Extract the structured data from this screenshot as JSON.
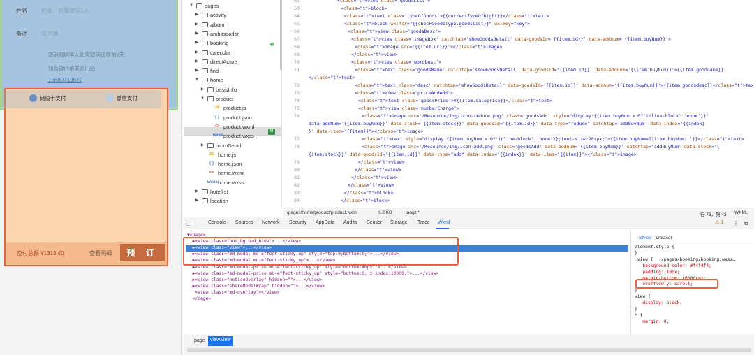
{
  "simulator": {
    "name_label": "姓名",
    "name_placeholder": "姓名，只需填写1人",
    "remark_label": "备注",
    "remark_placeholder": "可不填",
    "note_line1": "取消规则客人如需取消请提前3天;",
    "note_line2": "如有疑问请联系门店",
    "phone": "15680718672",
    "pay_option1": "储值卡支付",
    "pay_option2": "微信支付",
    "total_label": "应付总额 ¥1313.40",
    "detail_link": "查看明细",
    "book_button": "预 订",
    "colors": {
      "top_bg": "#a6c4de",
      "bottom_bg": "#fbd5ae",
      "button": "#c66b3d",
      "highlight": "#e8623a"
    }
  },
  "tree": {
    "items": [
      {
        "label": "pages",
        "kind": "folder-open"
      },
      {
        "label": "activity",
        "kind": "folder"
      },
      {
        "label": "album",
        "kind": "folder"
      },
      {
        "label": "ambassador",
        "kind": "folder"
      },
      {
        "label": "booking",
        "kind": "folder"
      },
      {
        "label": "calendar",
        "kind": "folder"
      },
      {
        "label": "directActive",
        "kind": "folder"
      },
      {
        "label": "find",
        "kind": "folder"
      },
      {
        "label": "home",
        "kind": "folder-open"
      },
      {
        "label": "basisInfo",
        "kind": "folder"
      },
      {
        "label": "product",
        "kind": "folder-open"
      },
      {
        "label": "product.js",
        "kind": "js"
      },
      {
        "label": "product.json",
        "kind": "json"
      },
      {
        "label": "product.wxml",
        "kind": "wxml"
      },
      {
        "label": "product.wxss",
        "kind": "wxss"
      },
      {
        "label": "roomDetail",
        "kind": "folder"
      },
      {
        "label": "home.js",
        "kind": "js"
      },
      {
        "label": "home.json",
        "kind": "json"
      },
      {
        "label": "home.wxml",
        "kind": "wxml"
      },
      {
        "label": "home.wxss",
        "kind": "wxss"
      },
      {
        "label": "hotellist",
        "kind": "folder"
      },
      {
        "label": "location",
        "kind": "folder"
      }
    ],
    "modified_badge": "M"
  },
  "code": {
    "lines": [
      {
        "n": "62",
        "text": "<view class='goodsList'>"
      },
      {
        "n": "63",
        "text": "<block>"
      },
      {
        "n": "64",
        "text": "<text class='typeOfGoods'>{{currentTypeOfRight}}</text>"
      },
      {
        "n": "65",
        "text": "<block wx:for=\"{{checkGoodsType.goodslist}}\" wx:key=\"key\">"
      },
      {
        "n": "66",
        "text": "<view class='goodsDesc'>"
      },
      {
        "n": "67",
        "text": "<view class='imageBox' catchtap='showGoodsDetail' data-goodsId='{{item.id}}' data-addnum='{{item.buyNum}}'>"
      },
      {
        "n": "68",
        "text": "<image src='{{item.url}}'></image>"
      },
      {
        "n": "69",
        "text": "</view>"
      },
      {
        "n": "70",
        "text": "<view class='wordDesc'>"
      },
      {
        "n": "71",
        "text": "<text class='goodsName' catchtap='showGoodsDetail' data-goodsId='{{item.id}}' data-addnum='{{item.buyNum}}'>{{item.goodname}}"
      },
      {
        "n": "",
        "text": "</text>"
      },
      {
        "n": "72",
        "text": "<text class='desc' catchtap='showGoodsDetail' data-goodsId='{{item.id}}' data-addnum='{{item.buyNum}}'>{{item.goodsdesc}}</text>"
      },
      {
        "n": "73",
        "text": "<view class='priceAndAdd'>"
      },
      {
        "n": "74",
        "text": "<text class='goodsPrice'>¥{{item.saleprice}}</text>"
      },
      {
        "n": "75",
        "text": "<view class='numberChange'>"
      },
      {
        "n": "76",
        "text": "<image src='/Resource/Img/icon-reduce.png' class='goodsAdd' style=\"display:{{item.buyNum > 0?'inline-block':'none'}}\""
      },
      {
        "n": "",
        "text": "data-addNum='{{item.buyNum}}' data-stock='{{item.stock}}' data-goodsId='{{item.id}}' data-type=\"reduce\" catchtap='addBuyNum' data-index='{{index}"
      },
      {
        "n": "",
        "text": "}' data-item=\"{{item}}\"></image>"
      },
      {
        "n": "77",
        "text": "<text style=\"display:{{item.buyNum > 0?'inline-block':'none'}};font-size:28rpx;\">{{item.buyNum>0?item.buyNum:''}}</text>"
      },
      {
        "n": "78",
        "text": "<image src='/Resource/Img/icon-add.png' class='goodsAdd' data-addnum='{{item.buyNum}}' catchtap='addBuyNum' data-stock='{"
      },
      {
        "n": "",
        "text": "{item.stock}}' data-goodsId='{{item.id}}' data-type=\"add\" data-index='{{index}}' data-item=\"{{item}}\"></image>"
      },
      {
        "n": "79",
        "text": "</view>"
      },
      {
        "n": "80",
        "text": "</view>"
      },
      {
        "n": "81",
        "text": "</view>"
      },
      {
        "n": "82",
        "text": "</view>"
      },
      {
        "n": "83",
        "text": "</block>"
      },
      {
        "n": "84",
        "text": "</block>"
      }
    ],
    "status_path": "/pages/home/product/product.wxml",
    "status_size": "6.2 KB",
    "status_branch": "tangzi*",
    "status_pos": "行 73，列 43",
    "status_lang": "WXML"
  },
  "devtools": {
    "tabs": [
      "Console",
      "Sources",
      "Network",
      "Security",
      "AppData",
      "Audits",
      "Sensor",
      "Storage",
      "Trace",
      "Wxml"
    ],
    "active_tab": "Wxml",
    "warning_count": "1",
    "dom_lines": [
      "▼<page>",
      "  ▶<view class=\"hud_bg hud_hide\">...</view>",
      "  ▶<view class=\"view\">...</view>",
      "  ▶<view class=\"md-modal md-effect-sticky_up\" style=\"top:0;bottom:0;\">...</view>",
      "  ▶<view class=\"md-modal md-effect-sticky_up\">...</view>",
      "  ▶<view class=\"md-modal-price md-effect-sticky_up\" style=\"bottom:40px;\">...</view>",
      "  ▶<view class=\"md-modal-price md-effect-sticky_up\" style=\"bottom:0; z-index:10000;\">...</view>",
      "  ▶<view class=\"noticeOverlay\" hidden=\"\">...</view>",
      "  ▶<view class=\"shareModalWrap\" hidden=\"\">...</view>",
      "   <view class=\"md-overlay\"></view>",
      "  </page>"
    ],
    "styles_tab": "Styles",
    "dataset_tab": "Dataset",
    "style_lines": [
      "element.style {",
      "}",
      ".view {  ./pages/booking/booking.wxss…",
      "   background-color: #f4f4f4;",
      "   padding: 10px;",
      "   margin-bottom: 16000rpx;",
      "   overflow-y: scroll;",
      "}",
      "view {",
      "   display: block;",
      "}",
      "* {",
      "   margin: 0;"
    ],
    "crumb_page": "page",
    "crumb_view": "view.view"
  }
}
